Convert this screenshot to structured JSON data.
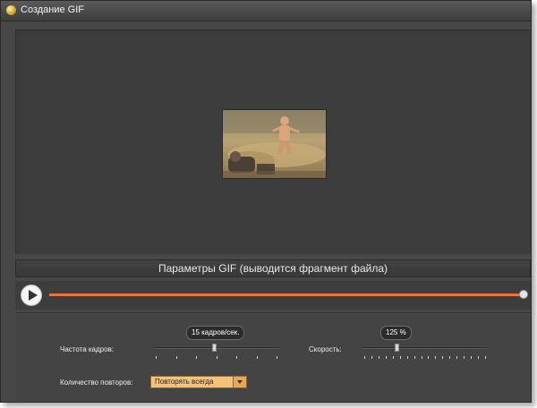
{
  "window": {
    "title": "Создание GIF"
  },
  "section": {
    "header": "Параметры GIF (выводится фрагмент файла)"
  },
  "params": {
    "framerate": {
      "label": "Частота кадров:",
      "value": "15 кадров/сек.",
      "level": 0.48
    },
    "speed": {
      "label": "Скорость:",
      "value": "125 %",
      "level": 0.27
    },
    "repeat": {
      "label": "Количество повторов:",
      "selected": "Повторять всегда"
    }
  },
  "player": {
    "progress": 1.0
  },
  "colors": {
    "accent": "#e8743a",
    "select_bg": "#f3c27b",
    "window_bg": "#474747"
  }
}
